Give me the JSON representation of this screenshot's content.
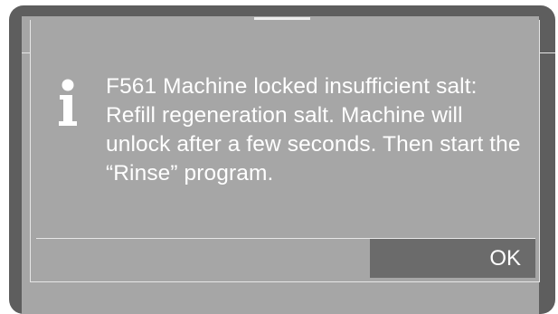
{
  "dialog": {
    "icon": "info-icon",
    "message": "F561 Machine locked insufficient salt: Refill regeneration salt. Machine will unlock after a few seconds. Then start the “Rinse” program.",
    "ok_label": "OK"
  },
  "colors": {
    "bezel": "#5e5e5e",
    "screen": "#a6a6a6",
    "button": "#6b6b6b",
    "text": "#ffffff"
  }
}
